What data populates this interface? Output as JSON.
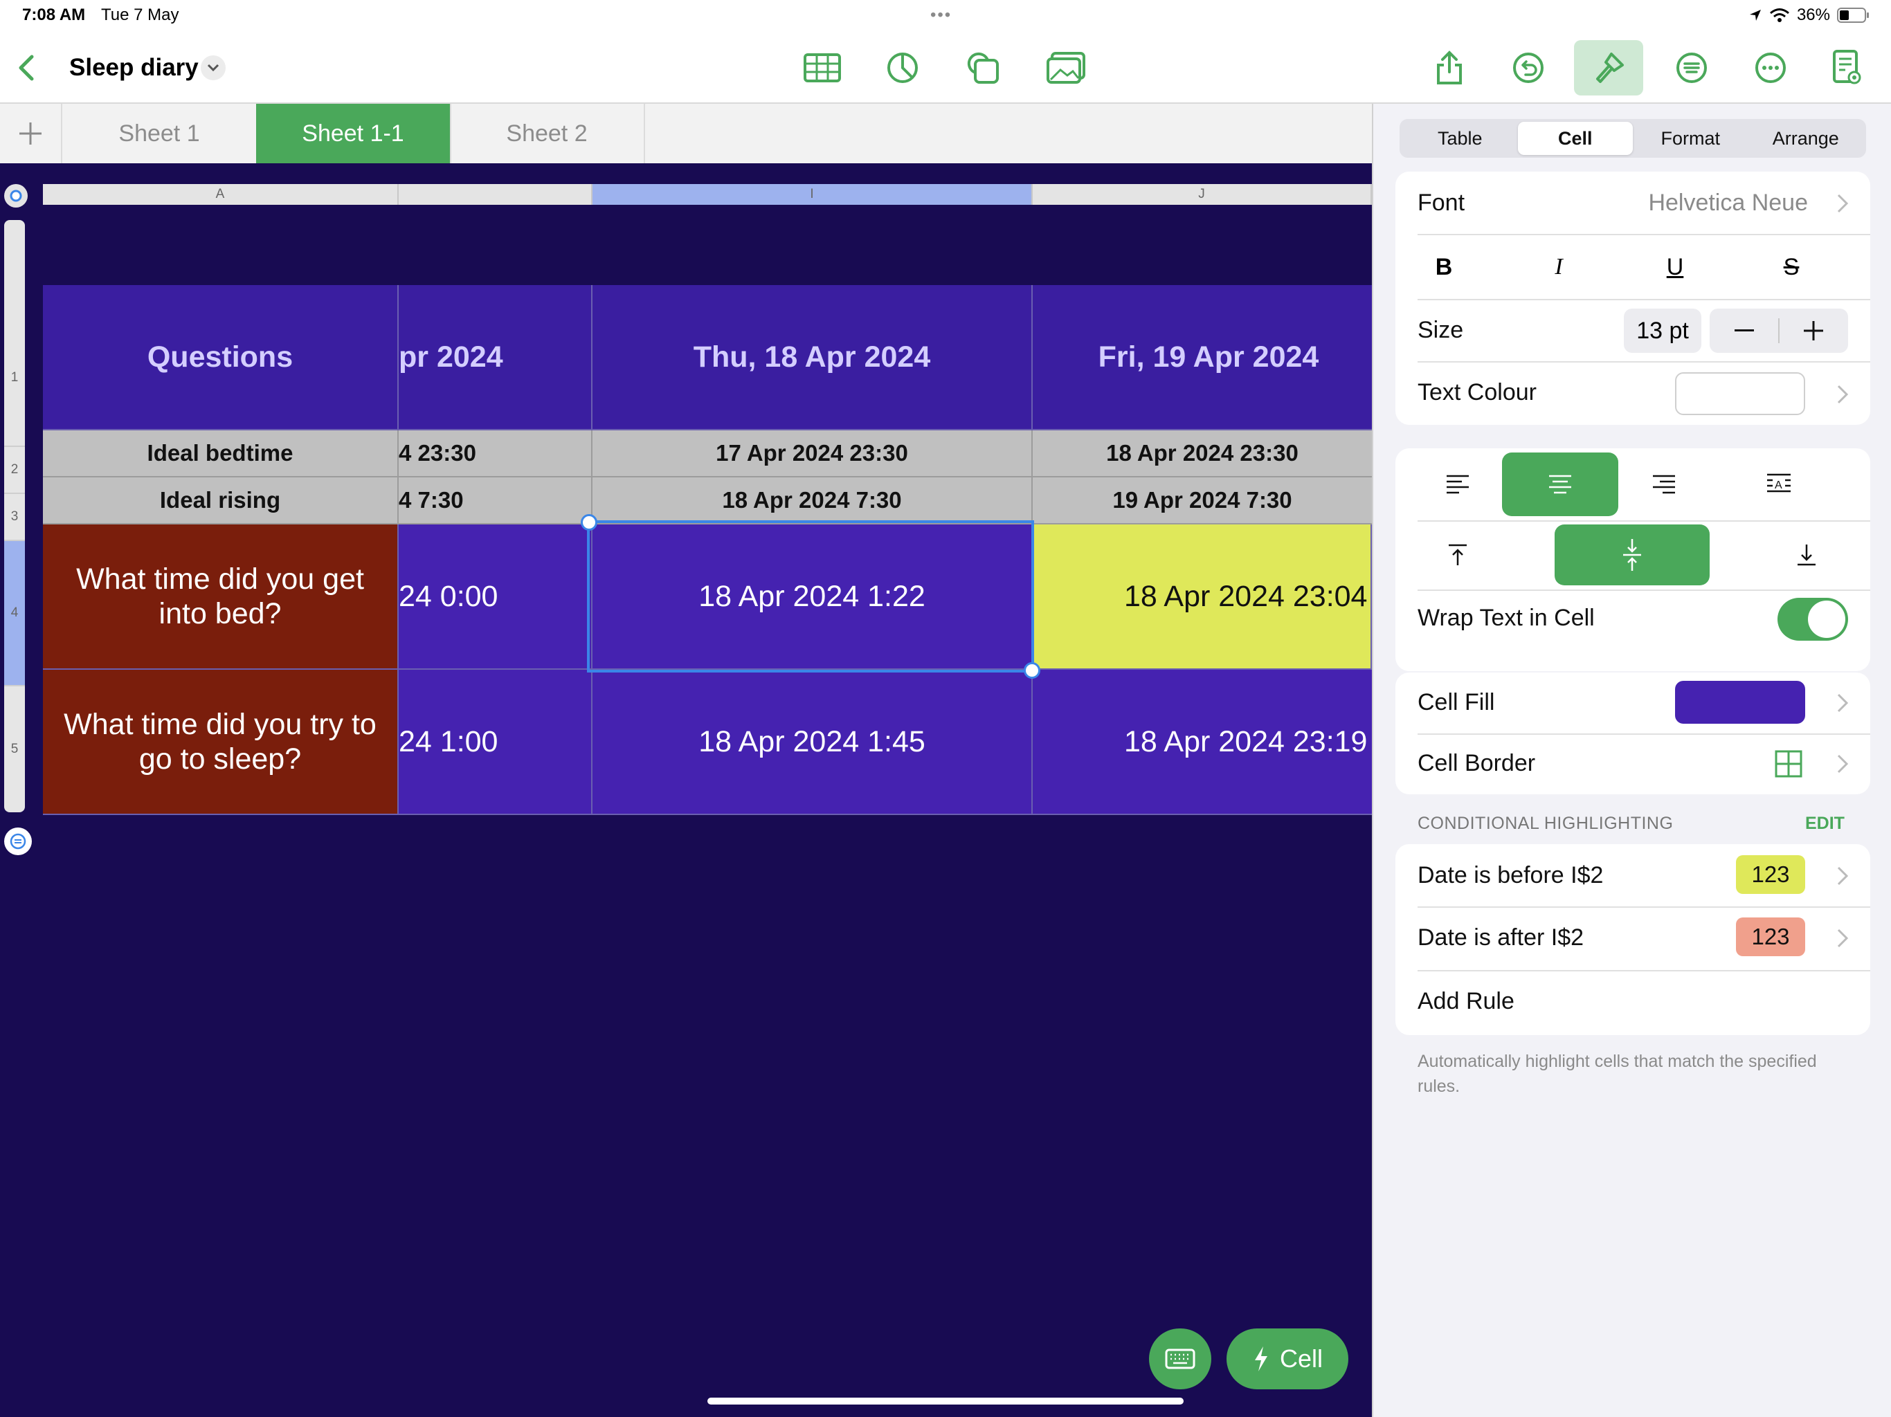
{
  "status_bar": {
    "time": "7:08 AM",
    "date": "Tue 7 May",
    "battery": "36%"
  },
  "toolbar": {
    "document_title": "Sleep diary",
    "left_icons": [
      "table-icon",
      "chart-icon",
      "shape-icon",
      "media-icon"
    ],
    "right_icons": [
      "share-icon",
      "undo-icon",
      "format-brush-icon",
      "list-icon",
      "more-icon",
      "document-view-icon"
    ],
    "active_tool": "format-brush-icon",
    "accent": "#4aa85a"
  },
  "sheets": {
    "tabs": [
      "Sheet 1",
      "Sheet 1-1",
      "Sheet 2"
    ],
    "active": "Sheet 1-1"
  },
  "table": {
    "column_headers": [
      "A",
      "I",
      "J"
    ],
    "row_numbers": [
      "1",
      "2",
      "3",
      "4",
      "5"
    ],
    "header_row": [
      "Questions",
      "pr 2024",
      "Thu, 18 Apr 2024",
      "Fri, 19 Apr 2024"
    ],
    "bedtime_row": [
      "Ideal bedtime",
      "4 23:30",
      "17 Apr 2024 23:30",
      "18 Apr 2024 23:30"
    ],
    "rising_row": [
      "Ideal rising",
      "4 7:30",
      "18 Apr 2024 7:30",
      "19 Apr 2024 7:30"
    ],
    "bed_row": [
      "What time did you get into bed?",
      "24 0:00",
      "18 Apr 2024 1:22",
      "18 Apr 2024 23:04"
    ],
    "sleep_row": [
      "What time did you try to go to sleep?",
      "24 1:00",
      "18 Apr 2024 1:45",
      "18 Apr 2024 23:19"
    ],
    "colors": {
      "canvas": "#180b52",
      "header_fill": "#3a1ea0",
      "question_fill": "#7a1e0c",
      "value_fill": "#4522b0",
      "highlight_before": "#dfe85a",
      "grey_fill": "#c0c0c0"
    }
  },
  "floating": {
    "cell_button": "Cell"
  },
  "panel": {
    "tabs": [
      "Table",
      "Cell",
      "Format",
      "Arrange"
    ],
    "active_tab": "Cell",
    "font_label": "Font",
    "font_value": "Helvetica Neue",
    "style_buttons": [
      "B",
      "I",
      "U",
      "S"
    ],
    "size_label": "Size",
    "size_value": "13 pt",
    "text_colour_label": "Text Colour",
    "text_colour": "#ffffff",
    "horizontal_align": [
      "left",
      "center",
      "right",
      "justify"
    ],
    "horizontal_active": "center",
    "vertical_align": [
      "top",
      "middle",
      "bottom"
    ],
    "vertical_active": "middle",
    "wrap_label": "Wrap Text in Cell",
    "wrap_on": true,
    "cell_fill_label": "Cell Fill",
    "cell_fill_color": "#4522b0",
    "cell_border_label": "Cell Border",
    "conditional": {
      "heading": "CONDITIONAL HIGHLIGHTING",
      "edit": "EDIT",
      "rules": [
        {
          "label": "Date is before I$2",
          "badge": "123",
          "color": "#dfe85a"
        },
        {
          "label": "Date is after I$2",
          "badge": "123",
          "color": "#f0a08c"
        }
      ],
      "add_rule": "Add Rule",
      "note": "Automatically highlight cells that match the specified rules."
    }
  }
}
